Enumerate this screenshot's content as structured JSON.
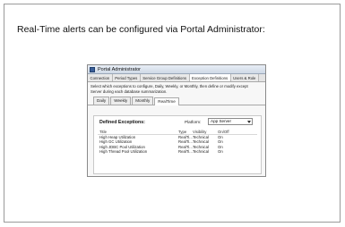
{
  "slide": {
    "title": "Real-Time alerts can be configured via Portal Administrator:"
  },
  "window": {
    "title": "Portal Administrator",
    "icon": "app-icon",
    "top_tabs": [
      {
        "label": "Connection",
        "active": false
      },
      {
        "label": "Period Types",
        "active": false
      },
      {
        "label": "Service Group Definitions",
        "active": false
      },
      {
        "label": "Exception Definitions",
        "active": true
      },
      {
        "label": "Users & Role",
        "active": false
      }
    ],
    "description_line1": "Select which exceptions to configure, Daily, Weekly, or Monthly, then define or modify except",
    "description_line2": "Server during each database summarization.",
    "sub_tabs": [
      {
        "label": "Daily",
        "active": false
      },
      {
        "label": "Weekly",
        "active": false
      },
      {
        "label": "Monthly",
        "active": false
      },
      {
        "label": "RealTime",
        "active": true
      }
    ],
    "defined_exceptions_label": "Defined Exceptions:",
    "platform_label": "Platform:",
    "platform_value": "App Server",
    "table": {
      "headers": {
        "title": "Title",
        "type": "Type",
        "visibility": "Visibility",
        "onoff": "On/Off"
      },
      "rows": [
        {
          "title": "High Heap Utilization",
          "type": "RealTi...",
          "visibility": "Technical",
          "onoff": "On"
        },
        {
          "title": "High GC Utilization",
          "type": "RealTi...",
          "visibility": "Technical",
          "onoff": "On"
        },
        {
          "title": "High JDBC Pool Utilization",
          "type": "RealTi...",
          "visibility": "Technical",
          "onoff": "On"
        },
        {
          "title": "High Thread Pool Utilization",
          "type": "RealTi...",
          "visibility": "Technical",
          "onoff": "On"
        }
      ]
    }
  }
}
